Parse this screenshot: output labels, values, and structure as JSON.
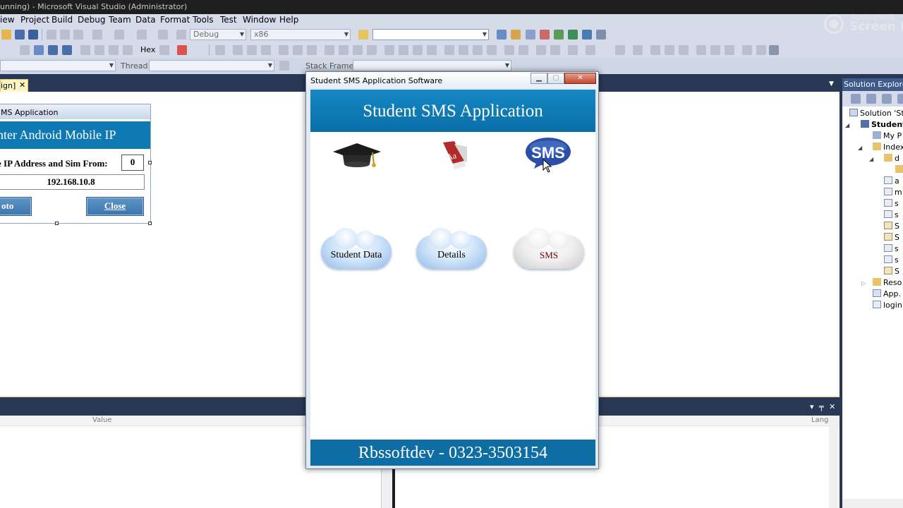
{
  "window_title": "unning) - Microsoft Visual Studio (Administrator)",
  "watermark": {
    "line1": "Apowersoft",
    "line2": "Screen Re"
  },
  "menu": [
    "iew",
    "Project",
    "Build",
    "Debug",
    "Team",
    "Data",
    "Format",
    "Tools",
    "Test",
    "Window",
    "Help"
  ],
  "toolbar": {
    "config": "Debug",
    "platform": "x86",
    "find_value": "",
    "hex_label": "Hex",
    "thread_label": "Thread:",
    "stack_frame_label": "Stack Frame:"
  },
  "doc_tab": {
    "label": "ign]",
    "close": "✕"
  },
  "designer_form": {
    "caption": "MS Application",
    "header": "nter Android Mobile IP",
    "ip_label": "e IP Address and Sim From:",
    "sim_value": "0",
    "ip_value": "192.168.10.8",
    "goto_label": "oto",
    "close_label": "Close"
  },
  "bottom_panel": {
    "value_header": "Value",
    "lang_header": "Lang",
    "controls": "▾ ╤ ✕"
  },
  "solution_explorer": {
    "title": "Solution Explorer",
    "items": [
      {
        "label": "Solution 'Stu",
        "depth": 0
      },
      {
        "label": "Student",
        "depth": 1,
        "bold": true
      },
      {
        "label": "My P",
        "depth": 2
      },
      {
        "label": "Index",
        "depth": 2
      },
      {
        "label": "d",
        "depth": 3
      },
      {
        "label": "",
        "depth": 4
      },
      {
        "label": "a",
        "depth": 3
      },
      {
        "label": "m",
        "depth": 3
      },
      {
        "label": "s",
        "depth": 3
      },
      {
        "label": "s",
        "depth": 3
      },
      {
        "label": "S",
        "depth": 3
      },
      {
        "label": "S",
        "depth": 3
      },
      {
        "label": "s",
        "depth": 3
      },
      {
        "label": "s",
        "depth": 3
      },
      {
        "label": "S",
        "depth": 3
      },
      {
        "label": "Reso",
        "depth": 2
      },
      {
        "label": "App.",
        "depth": 2
      },
      {
        "label": "login",
        "depth": 2
      }
    ]
  },
  "app": {
    "title": "Student SMS Application Software",
    "header": "Student SMS Application",
    "footer": "Rbssoftdev - 0323-3503154",
    "buttons": {
      "student_data": "Student Data",
      "details": "Details",
      "sms": "SMS"
    },
    "window_controls": {
      "min": "▁",
      "max": "▢",
      "close": "✕"
    }
  },
  "colors": {
    "ide_chrome": "#293955",
    "app_header": "#0e79b2",
    "doc_tab": "#fff7c5"
  }
}
